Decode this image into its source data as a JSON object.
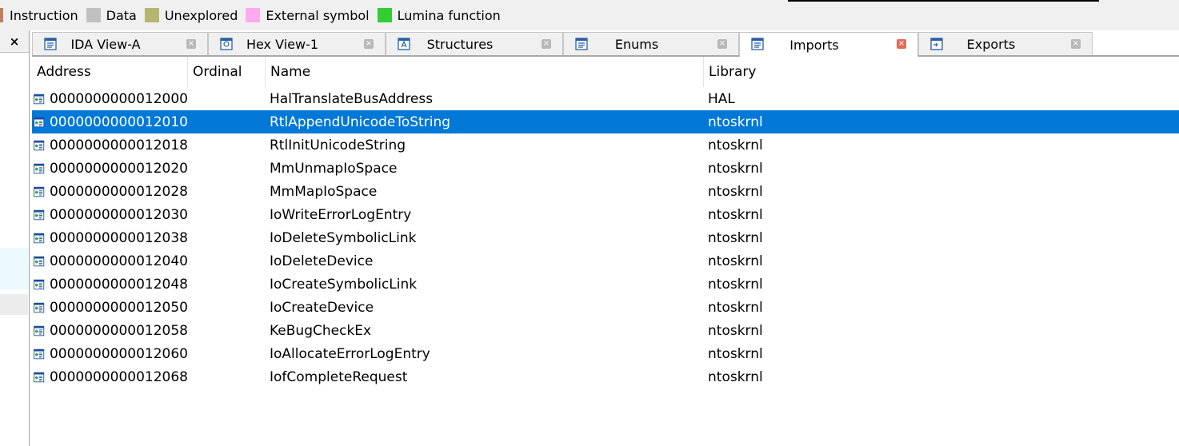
{
  "legend": [
    {
      "label": "Instruction",
      "color": "#c08060"
    },
    {
      "label": "Data",
      "color": "#c0c0c0"
    },
    {
      "label": "Unexplored",
      "color": "#b5b570"
    },
    {
      "label": "External symbol",
      "color": "#ffaaee"
    },
    {
      "label": "Lumina function",
      "color": "#33cc33"
    }
  ],
  "left_panel": {
    "close_label": "×"
  },
  "tabs": [
    {
      "label": "IDA View-A",
      "icon": "disassembly-icon",
      "active": false
    },
    {
      "label": "Hex View-1",
      "icon": "hex-icon",
      "active": false
    },
    {
      "label": "Structures",
      "icon": "structures-icon",
      "active": false
    },
    {
      "label": "Enums",
      "icon": "enums-icon",
      "active": false
    },
    {
      "label": "Imports",
      "icon": "imports-icon",
      "active": true
    },
    {
      "label": "Exports",
      "icon": "exports-icon",
      "active": false
    }
  ],
  "tab_close_glyph": "×",
  "columns": [
    "Address",
    "Ordinal",
    "Name",
    "Library"
  ],
  "rows": [
    {
      "address": "0000000000012000",
      "ordinal": "",
      "name": "HalTranslateBusAddress",
      "library": "HAL"
    },
    {
      "address": "0000000000012010",
      "ordinal": "",
      "name": "RtlAppendUnicodeToString",
      "library": "ntoskrnl",
      "selected": true
    },
    {
      "address": "0000000000012018",
      "ordinal": "",
      "name": "RtlInitUnicodeString",
      "library": "ntoskrnl"
    },
    {
      "address": "0000000000012020",
      "ordinal": "",
      "name": "MmUnmapIoSpace",
      "library": "ntoskrnl"
    },
    {
      "address": "0000000000012028",
      "ordinal": "",
      "name": "MmMapIoSpace",
      "library": "ntoskrnl"
    },
    {
      "address": "0000000000012030",
      "ordinal": "",
      "name": "IoWriteErrorLogEntry",
      "library": "ntoskrnl"
    },
    {
      "address": "0000000000012038",
      "ordinal": "",
      "name": "IoDeleteSymbolicLink",
      "library": "ntoskrnl"
    },
    {
      "address": "0000000000012040",
      "ordinal": "",
      "name": "IoDeleteDevice",
      "library": "ntoskrnl"
    },
    {
      "address": "0000000000012048",
      "ordinal": "",
      "name": "IoCreateSymbolicLink",
      "library": "ntoskrnl"
    },
    {
      "address": "0000000000012050",
      "ordinal": "",
      "name": "IoCreateDevice",
      "library": "ntoskrnl"
    },
    {
      "address": "0000000000012058",
      "ordinal": "",
      "name": "KeBugCheckEx",
      "library": "ntoskrnl"
    },
    {
      "address": "0000000000012060",
      "ordinal": "",
      "name": "IoAllocateErrorLogEntry",
      "library": "ntoskrnl"
    },
    {
      "address": "0000000000012068",
      "ordinal": "",
      "name": "IofCompleteRequest",
      "library": "ntoskrnl"
    }
  ],
  "colors": {
    "selection": "#0078d7",
    "active_tab_close": "#e06c5a"
  }
}
